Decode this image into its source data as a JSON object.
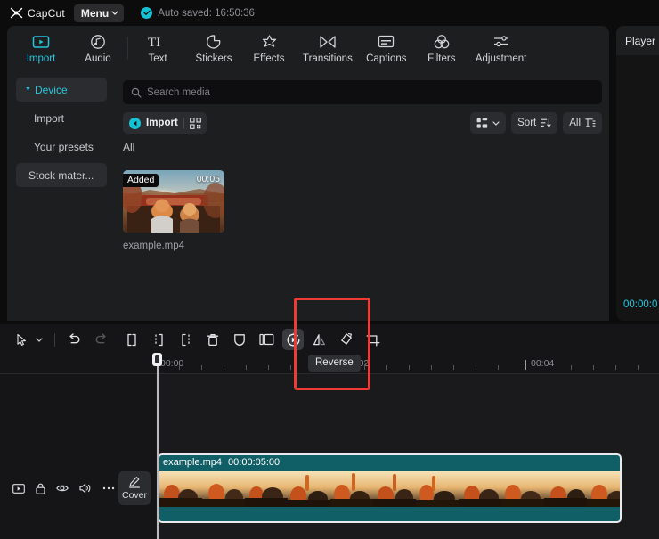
{
  "titlebar": {
    "brand": "CapCut",
    "menu_label": "Menu",
    "autosave_text": "Auto saved: 16:50:36",
    "check_icon": "check-circle-icon",
    "accent": "#17c1d4"
  },
  "topnav": {
    "items": [
      {
        "label": "Import",
        "icon": "import-media-icon",
        "active": true
      },
      {
        "label": "Audio",
        "icon": "audio-note-icon",
        "active": false
      },
      {
        "label": "Text",
        "icon": "text-ti-icon",
        "active": false
      },
      {
        "label": "Stickers",
        "icon": "sticker-icon",
        "active": false
      },
      {
        "label": "Effects",
        "icon": "effects-star-icon",
        "active": false
      },
      {
        "label": "Transitions",
        "icon": "transitions-icon",
        "active": false
      },
      {
        "label": "Captions",
        "icon": "captions-icon",
        "active": false
      },
      {
        "label": "Filters",
        "icon": "filters-circles-icon",
        "active": false
      },
      {
        "label": "Adjustment",
        "icon": "adjustment-sliders-icon",
        "active": false
      }
    ]
  },
  "sidebar": {
    "items": [
      {
        "label": "Device",
        "selected": true,
        "expanded": true
      },
      {
        "label": "Import",
        "selected": false
      },
      {
        "label": "Your presets",
        "selected": false
      },
      {
        "label": "Stock mater...",
        "selected": true
      }
    ]
  },
  "media_panel": {
    "search": {
      "placeholder": "Search media",
      "value": "",
      "icon": "search-icon"
    },
    "import_button": {
      "label": "Import",
      "icon": "import-arrow-icon",
      "secondary_icon": "qr-scan-icon"
    },
    "view_toggle": {
      "icon": "grid-view-icon",
      "caret": "chevron-down-icon"
    },
    "sort_button": {
      "label": "Sort",
      "icon": "sort-desc-icon"
    },
    "filter_button": {
      "label": "All",
      "icon": "filter-icon"
    },
    "section_heading": "All",
    "items": [
      {
        "name": "example.mp4",
        "badge": "Added",
        "duration": "00:05"
      }
    ]
  },
  "player_panel": {
    "tab_label": "Player",
    "timecode": "00:00:0",
    "timecode_color": "#24c6dc"
  },
  "timeline_toolbar": {
    "buttons": [
      {
        "name": "select-tool",
        "icon": "cursor-arrow-icon",
        "state": "normal"
      },
      {
        "name": "select-tool-dropdown",
        "icon": "chevron-down-icon",
        "state": "normal"
      },
      {
        "name": "undo",
        "icon": "undo-icon",
        "state": "normal"
      },
      {
        "name": "redo",
        "icon": "redo-icon",
        "state": "disabled"
      },
      {
        "name": "split",
        "icon": "split-icon",
        "state": "normal"
      },
      {
        "name": "trim-left",
        "icon": "trim-left-icon",
        "state": "normal"
      },
      {
        "name": "trim-right",
        "icon": "trim-right-icon",
        "state": "normal"
      },
      {
        "name": "delete",
        "icon": "trash-icon",
        "state": "normal"
      },
      {
        "name": "freeze",
        "icon": "shield-icon",
        "state": "normal"
      },
      {
        "name": "split-screen",
        "icon": "split-screen-icon",
        "state": "normal"
      },
      {
        "name": "reverse",
        "icon": "reverse-play-icon",
        "state": "hovered"
      },
      {
        "name": "mirror",
        "icon": "mirror-flip-icon",
        "state": "normal"
      },
      {
        "name": "rotate",
        "icon": "rotate-diamond-icon",
        "state": "normal"
      },
      {
        "name": "crop",
        "icon": "crop-icon",
        "state": "normal"
      }
    ],
    "tooltip": {
      "text": "Reverse",
      "for": "reverse"
    },
    "annotation": {
      "color": "#ef3b33",
      "targets": "reverse-button-and-tooltip"
    }
  },
  "timeline": {
    "ruler_labels": [
      "00:00",
      "00:02",
      "00:04"
    ],
    "playhead_position": "00:00",
    "track_header": {
      "icons": [
        "video-track-icon",
        "lock-icon",
        "eye-icon",
        "speaker-icon",
        "more-options-icon"
      ],
      "cover_button": {
        "label": "Cover",
        "icon": "pencil-edit-icon"
      }
    },
    "clips": [
      {
        "name": "example.mp4",
        "duration": "00:00:05:00",
        "selected": true,
        "color": "#105f66"
      }
    ]
  }
}
